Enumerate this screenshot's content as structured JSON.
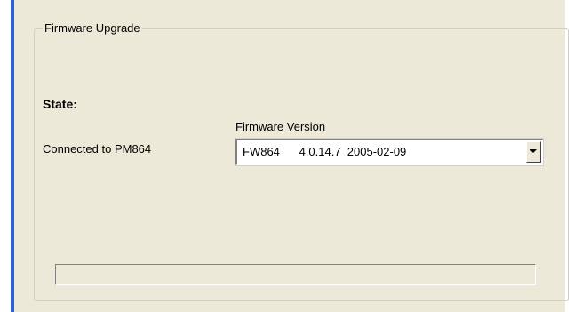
{
  "group": {
    "title": "Firmware Upgrade"
  },
  "state": {
    "label": "State:",
    "status_text": "Connected to PM864"
  },
  "firmware": {
    "label": "Firmware Version",
    "selected": "FW864      4.0.14.7  2005-02-09",
    "dropdown_icon": "chevron-down-icon"
  },
  "progress": {
    "value_fraction": 0
  },
  "colors": {
    "panel_bg": "#ece9d8",
    "accent": "#2d5fd6"
  }
}
